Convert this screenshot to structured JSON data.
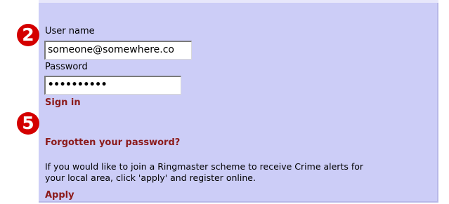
{
  "steps": {
    "step_a": "2",
    "step_b": "5"
  },
  "form": {
    "username_label": "User name",
    "username_value": "someone@somewhere.co",
    "password_label": "Password",
    "password_value": "••••••••••",
    "signin_label": "Sign in",
    "forgot_label": "Forgotten your password?",
    "info_line1": "If you would like to join a Ringmaster scheme to receive Crime alerts for",
    "info_line2": "your local area, click 'apply' and register online.",
    "apply_label": "Apply"
  },
  "colors": {
    "panel_bg": "#cccdf7",
    "link": "#8b1a1a",
    "badge": "#d40000"
  }
}
